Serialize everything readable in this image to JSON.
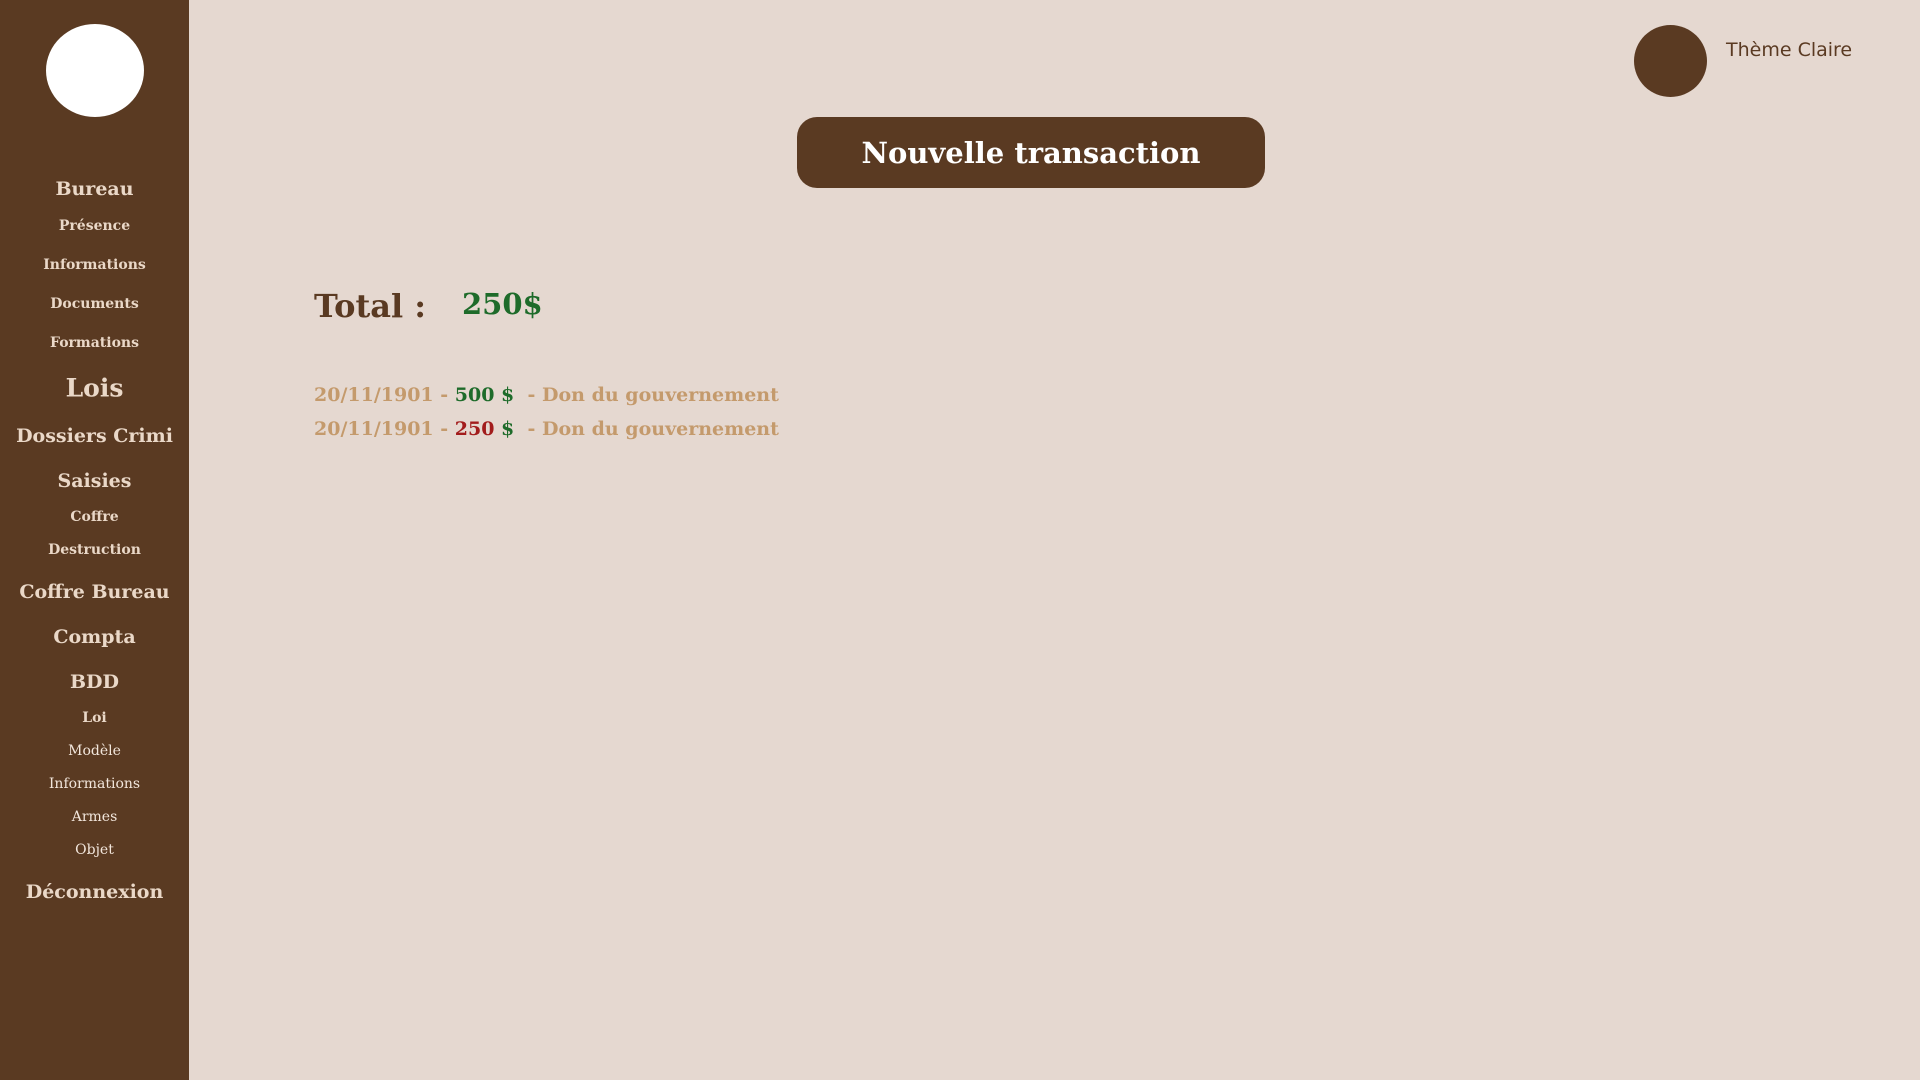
{
  "sidebar": {
    "items": [
      {
        "label": "Bureau"
      },
      {
        "label": "Présence"
      },
      {
        "label": "Informations"
      },
      {
        "label": "Documents"
      },
      {
        "label": "Formations"
      },
      {
        "label": "Lois"
      },
      {
        "label": "Dossiers Crimi"
      },
      {
        "label": "Saisies"
      },
      {
        "label": "Coffre"
      },
      {
        "label": "Destruction"
      },
      {
        "label": "Coffre Bureau"
      },
      {
        "label": "Compta"
      },
      {
        "label": "BDD"
      },
      {
        "label": "Loi"
      },
      {
        "label": "Modèle"
      },
      {
        "label": "Informations"
      },
      {
        "label": "Armes"
      },
      {
        "label": "Objet"
      },
      {
        "label": "Déconnexion"
      }
    ]
  },
  "header": {
    "theme_label": "Thème Claire",
    "new_transaction_label": "Nouvelle transaction"
  },
  "main": {
    "total_label": "Total :",
    "total_value": "250$",
    "transactions": [
      {
        "date": "20/11/1901",
        "sep": " - ",
        "amount": "500",
        "currency": " $",
        "description": "  - Don du gouvernement",
        "type": "credit"
      },
      {
        "date": "20/11/1901",
        "sep": " - ",
        "amount": "250",
        "currency": " $",
        "description": "  - Don du gouvernement",
        "type": "debit"
      }
    ]
  },
  "colors": {
    "sidebar_bg": "#5a3a22",
    "page_bg": "#e5d8d0",
    "positive": "#1e6b2a",
    "negative": "#a21c1c",
    "muted_text": "#c49a6c"
  }
}
